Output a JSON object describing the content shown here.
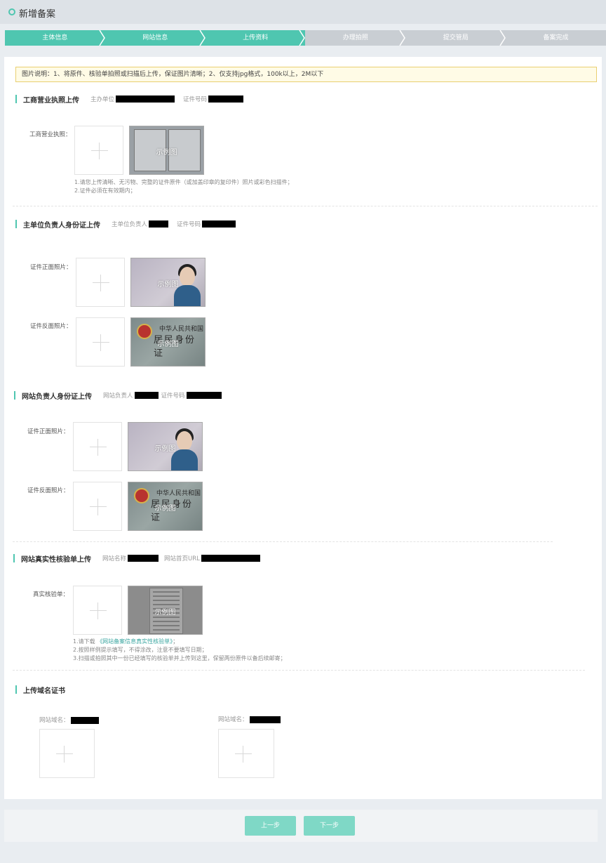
{
  "header": {
    "title": "新增备案"
  },
  "steps": [
    "主体信息",
    "网站信息",
    "上传资料",
    "办理拍照",
    "提交管局",
    "备案完成"
  ],
  "notice": "图片说明：1、将原件、核验单拍照或扫描后上传，保证图片清晰；2、仅支持jpg格式，100k以上，2M以下",
  "sample_caption": "示例图",
  "section1": {
    "title": "工商营业执照上传",
    "sub1": "主办单位",
    "sub2": "证件号码",
    "field_label": "工商营业执照：",
    "hint1": "1.请您上传清晰、无污物、完整的证件原件（或加盖印章的复印件）照片或彩色扫描件；",
    "hint2": "2.证件必须在有效期内；"
  },
  "section2": {
    "title": "主单位负责人身份证上传",
    "sub1": "主单位负责人",
    "sub2": "证件号码",
    "front_label": "证件正面照片：",
    "back_label": "证件反面照片："
  },
  "section3": {
    "title": "网站负责人身份证上传",
    "sub1": "网站负责人",
    "sub2": "证件号码",
    "front_label": "证件正面照片：",
    "back_label": "证件反面照片："
  },
  "section4": {
    "title": "网站真实性核验单上传",
    "sub1": "网站名称",
    "sub2": "网站首页URL",
    "field_label": "真实核验单：",
    "hint1_prefix": "1.请下载",
    "hint1_link": "《网站备案信息真实性核验单》",
    "hint1_suffix": "；",
    "hint2": "2.按照样例提示填写，不得涂改，注意不要填写日期；",
    "hint3": "3.扫描或拍照其中一份已经填写的核验单并上传到这里，保留两份原件以备后续邮寄；"
  },
  "section5": {
    "title": "上传域名证书",
    "domain_label_1": "网站域名：",
    "domain_label_2": "网站域名："
  },
  "id_card_back": {
    "line1": "中华人民共和国",
    "line2": "居民身份证"
  },
  "buttons": {
    "prev": "上一步",
    "next": "下一步"
  },
  "colors": {
    "accent": "#4fc6b0",
    "step_inactive": "#c9ced3",
    "button": "#7fd8c6"
  }
}
